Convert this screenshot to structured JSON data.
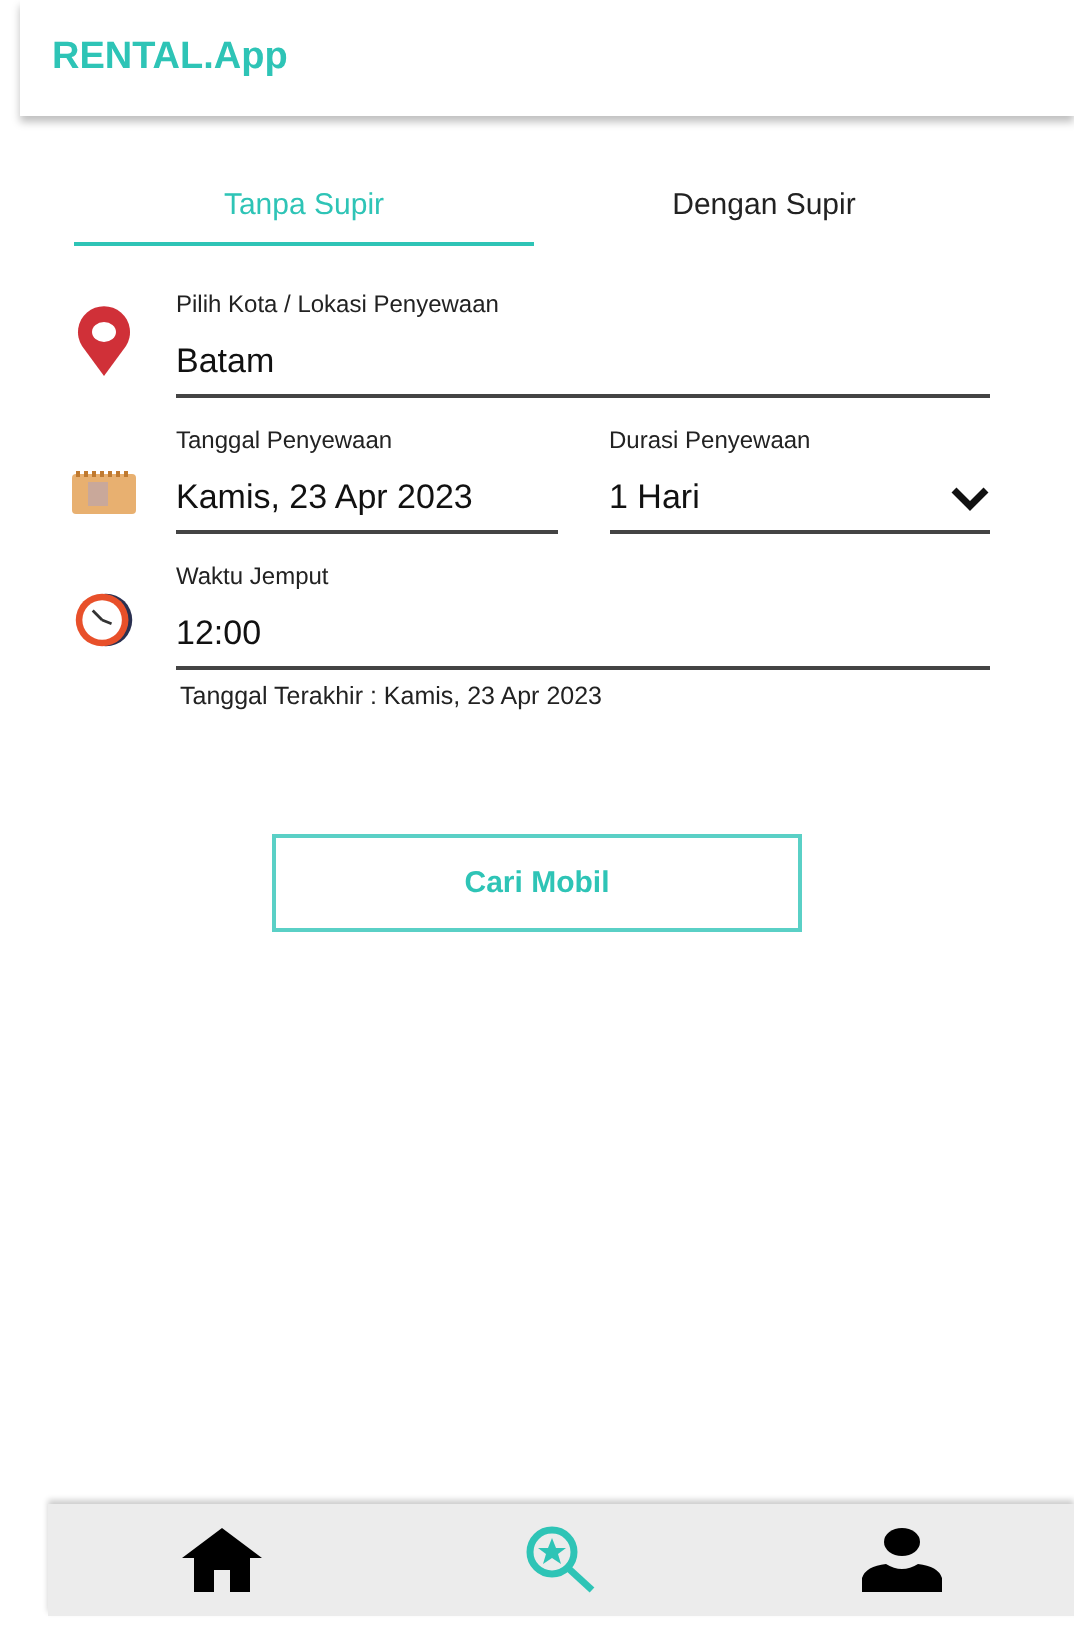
{
  "app_title": "RENTAL.App",
  "tabs": [
    {
      "label": "Tanpa Supir",
      "selected": true
    },
    {
      "label": "Dengan Supir",
      "selected": false
    }
  ],
  "location": {
    "label": "Pilih Kota / Lokasi Penyewaan",
    "value": "Batam"
  },
  "date": {
    "label": "Tanggal Penyewaan",
    "value": "Kamis, 23 Apr 2023"
  },
  "duration": {
    "label": "Durasi Penyewaan",
    "value": "1 Hari"
  },
  "pickup_time": {
    "label": "Waktu Jemput",
    "value": "12:00"
  },
  "end_date_note": "Tanggal  Terakhir : Kamis, 23 Apr 2023",
  "search_button": "Cari Mobil",
  "bottom_nav": [
    {
      "kind": "home",
      "selected": false
    },
    {
      "kind": "search",
      "selected": true
    },
    {
      "kind": "profile",
      "selected": false
    }
  ]
}
